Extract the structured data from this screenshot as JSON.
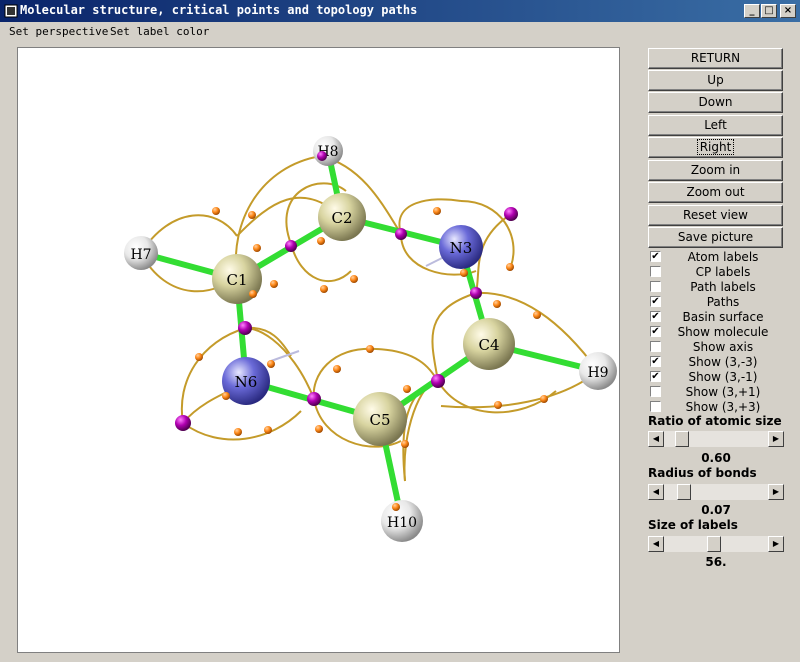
{
  "window": {
    "title": "Molecular structure, critical points and topology paths",
    "minimize_glyph": "_",
    "maximize_glyph": "□",
    "close_glyph": "×"
  },
  "menu": {
    "items": [
      "Set perspective",
      "Set label color"
    ]
  },
  "buttons": [
    "RETURN",
    "Up",
    "Down",
    "Left",
    "Right",
    "Zoom in",
    "Zoom out",
    "Reset view",
    "Save picture"
  ],
  "focused_button": "Right",
  "checkboxes": [
    {
      "label": "Atom labels",
      "checked": true
    },
    {
      "label": "CP labels",
      "checked": false
    },
    {
      "label": "Path labels",
      "checked": false
    },
    {
      "label": "Paths",
      "checked": true
    },
    {
      "label": "Basin surface",
      "checked": true
    },
    {
      "label": "Show molecule",
      "checked": true
    },
    {
      "label": "Show axis",
      "checked": false
    },
    {
      "label": "Show (3,-3)",
      "checked": true
    },
    {
      "label": "Show (3,-1)",
      "checked": true
    },
    {
      "label": "Show (3,+1)",
      "checked": false
    },
    {
      "label": "Show (3,+3)",
      "checked": false
    }
  ],
  "sliders": [
    {
      "label": "Ratio of atomic size",
      "value": "0.60",
      "fraction": 0.12
    },
    {
      "label": "Radius of bonds",
      "value": "0.07",
      "fraction": 0.14
    },
    {
      "label": "Size of labels",
      "value": "56.",
      "fraction": 0.48
    }
  ],
  "atoms": [
    {
      "label": "C1",
      "element": "C"
    },
    {
      "label": "C2",
      "element": "C"
    },
    {
      "label": "N3",
      "element": "N"
    },
    {
      "label": "C4",
      "element": "C"
    },
    {
      "label": "C5",
      "element": "C"
    },
    {
      "label": "N6",
      "element": "N"
    },
    {
      "label": "H7",
      "element": "H"
    },
    {
      "label": "H8",
      "element": "H"
    },
    {
      "label": "H9",
      "element": "H"
    },
    {
      "label": "H10",
      "element": "H"
    }
  ],
  "colors": {
    "carbon": "#d8d4a0",
    "nitrogen": "#6a6ad8",
    "hydrogen": "#ececec",
    "bond": "#33dd33",
    "path": "#c49b2a",
    "bcp": "#b000b0",
    "path_point": "#ff8a1a"
  }
}
